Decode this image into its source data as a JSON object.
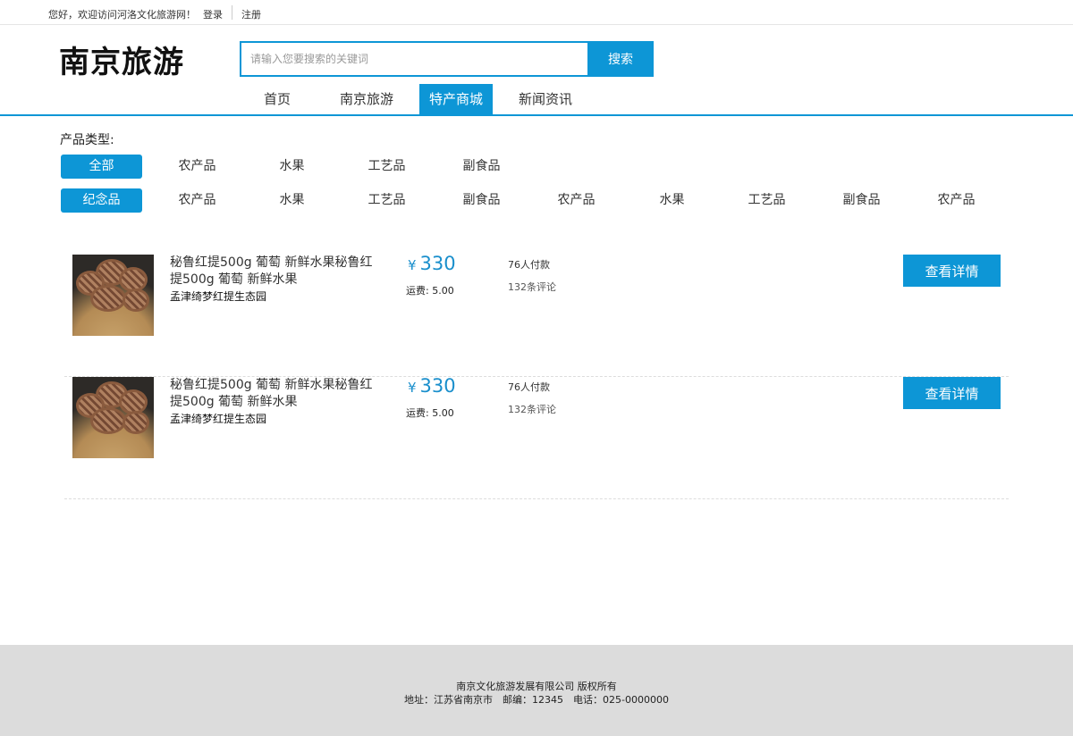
{
  "topbar": {
    "welcome": "您好，欢迎访问河洛文化旅游网！",
    "login": "登录",
    "register": "注册"
  },
  "header": {
    "logo": "南京旅游",
    "search_placeholder": "请输入您要搜索的关键词",
    "search_button": "搜索"
  },
  "nav": {
    "items": [
      {
        "label": "首页"
      },
      {
        "label": "南京旅游"
      },
      {
        "label": "特产商城",
        "active": true
      },
      {
        "label": "新闻资讯"
      }
    ]
  },
  "filter": {
    "label": "产品类型:",
    "row1": [
      "全部",
      "农产品",
      "水果",
      "工艺品",
      "副食品"
    ],
    "row2": [
      "纪念品",
      "农产品",
      "水果",
      "工艺品",
      "副食品",
      "农产品",
      "水果",
      "工艺品",
      "副食品",
      "农产品"
    ]
  },
  "products": [
    {
      "title": "秘鲁红提500g 葡萄 新鲜水果秘鲁红提500g 葡萄 新鲜水果",
      "shop": "孟津绮梦红提生态园",
      "currency": "¥",
      "price": "330",
      "shipping": "运费: 5.00",
      "paid": "76人付款",
      "comments": "132条评论",
      "button": "查看详情"
    },
    {
      "title": "秘鲁红提500g 葡萄 新鲜水果秘鲁红提500g 葡萄 新鲜水果",
      "shop": "孟津绮梦红提生态园",
      "currency": "¥",
      "price": "330",
      "shipping": "运费: 5.00",
      "paid": "76人付款",
      "comments": "132条评论",
      "button": "查看详情"
    }
  ],
  "footer": {
    "line1": "南京文化旅游发展有限公司 版权所有",
    "line2": "地址：江苏省南京市　邮编：12345　电话：025-0000000"
  },
  "colors": {
    "accent": "#0d96d6",
    "price": "#1a8fcc",
    "footer_bg": "#dcdcdc"
  }
}
